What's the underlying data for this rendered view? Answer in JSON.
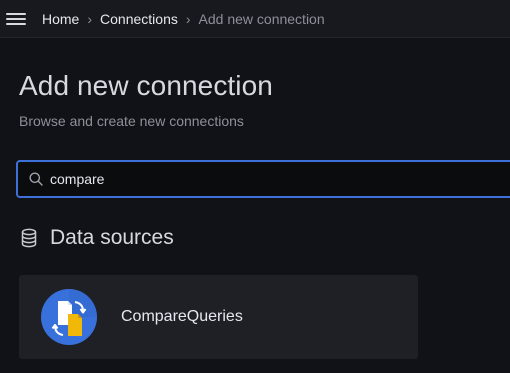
{
  "breadcrumbs": [
    "Home",
    "Connections",
    "Add new connection"
  ],
  "page": {
    "title": "Add new connection",
    "subtitle": "Browse and create new connections"
  },
  "search": {
    "value": "compare",
    "icon": "search-icon"
  },
  "section": {
    "title": "Data sources",
    "icon": "database-icon"
  },
  "results": [
    {
      "name": "CompareQueries",
      "logo": "compare-queries-logo"
    }
  ],
  "colors": {
    "background": "#111217",
    "accent_focus": "#3d71d9",
    "card": "#1f2026",
    "logo_blue": "#3871dc",
    "logo_yellow": "#f2b807"
  }
}
